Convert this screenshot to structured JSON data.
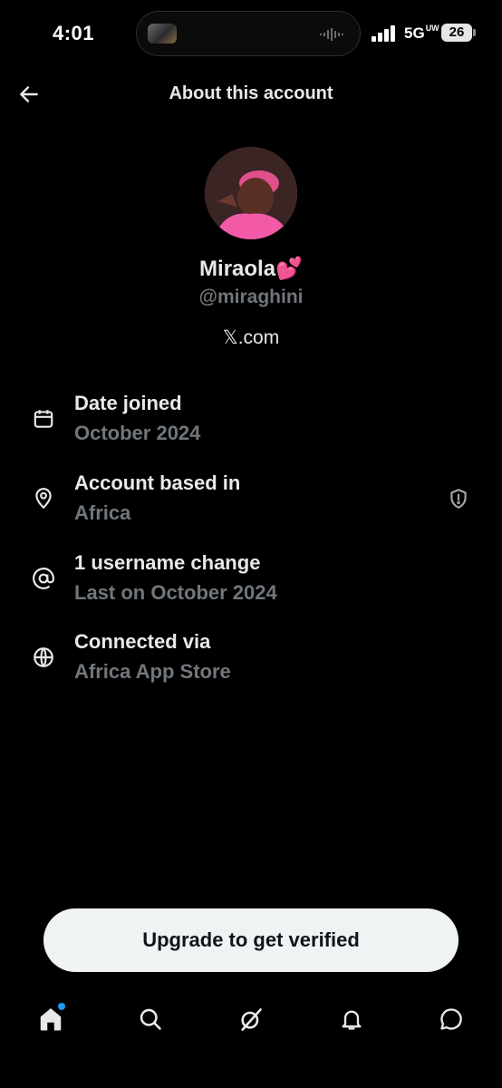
{
  "status_bar": {
    "time": "4:01",
    "network": "5G",
    "network_sup": "UW",
    "battery": "26"
  },
  "header": {
    "title": "About this account",
    "back_icon": "arrow-left-icon"
  },
  "profile": {
    "display_name": "Miraola💕",
    "handle": "@miraghini",
    "domain": "𝕏.com"
  },
  "info": [
    {
      "title": "Date joined",
      "subtitle": "October 2024",
      "icon": "calendar-icon"
    },
    {
      "title": "Account based in",
      "subtitle": "Africa",
      "icon": "location-pin-icon",
      "trailing_icon": "shield-alert-icon"
    },
    {
      "title": "1 username change",
      "subtitle": "Last on October 2024",
      "icon": "at-sign-icon"
    },
    {
      "title": "Connected via",
      "subtitle": "Africa App Store",
      "icon": "globe-icon"
    }
  ],
  "cta": {
    "label": "Upgrade to get verified"
  },
  "nav": {
    "items": [
      "home-icon",
      "search-icon",
      "grok-icon",
      "notifications-icon",
      "messages-icon"
    ],
    "active": "home-icon",
    "accent": "#1d9bf0"
  },
  "colors": {
    "background": "#000000",
    "primary_text": "#e7e9ea",
    "secondary_text": "#71767b",
    "button_bg": "#eff3f4"
  }
}
